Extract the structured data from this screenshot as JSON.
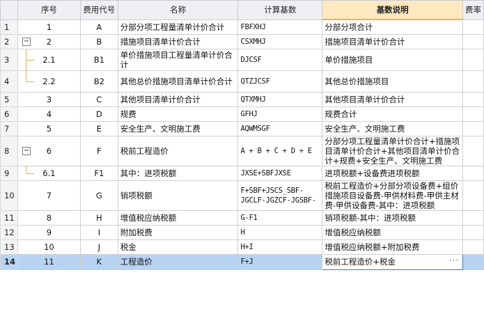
{
  "headers": {
    "seq": "序号",
    "code": "费用代号",
    "name": "名称",
    "base": "计算基数",
    "desc": "基数说明",
    "rate": "费率"
  },
  "rows": [
    {
      "rownum": "1",
      "seq": "1",
      "code": "A",
      "name": "分部分项工程量清单计价合计",
      "base": "FBFXHJ",
      "desc": "分部分项合计"
    },
    {
      "rownum": "2",
      "seq": "2",
      "code": "B",
      "name": "措施项目清单计价合计",
      "base": "CSXMHJ",
      "desc": "措施项目清单计价合计",
      "toggle": "−"
    },
    {
      "rownum": "3",
      "seq": "2.1",
      "code": "B1",
      "name": "单价措施项目工程量清单计价合计",
      "base": "DJCSF",
      "desc": "单价措施项目"
    },
    {
      "rownum": "4",
      "seq": "2.2",
      "code": "B2",
      "name": "其他总价措施项目清单计价合计",
      "base": "QTZJCSF",
      "desc": "其他总价措施项目"
    },
    {
      "rownum": "5",
      "seq": "3",
      "code": "C",
      "name": "其他项目清单计价合计",
      "base": "QTXMHJ",
      "desc": "其他项目清单计价合计"
    },
    {
      "rownum": "6",
      "seq": "4",
      "code": "D",
      "name": "规费",
      "base": "GFHJ",
      "desc": "规费合计"
    },
    {
      "rownum": "7",
      "seq": "5",
      "code": "E",
      "name": "安全生产、文明施工费",
      "base": "AQWMSGF",
      "desc": "安全生产、文明施工费"
    },
    {
      "rownum": "8",
      "seq": "6",
      "code": "F",
      "name": "税前工程造价",
      "base": "A + B + C + D + E",
      "desc": "分部分项工程量清单计价合计+措施项目清单计价合计+其他项目清单计价合计+规费+安全生产、文明施工费",
      "toggle": "−"
    },
    {
      "rownum": "9",
      "seq": "6.1",
      "code": "F1",
      "name": "其中：进项税额",
      "base": "JXSE+SBFJXSE",
      "desc": "进项税额+设备费进项税额"
    },
    {
      "rownum": "10",
      "seq": "7",
      "code": "G",
      "name": "销项税额",
      "base": "F+SBF+JSCS_SBF-JGCLF-JGZCF-JGSBF-",
      "desc": "税前工程造价+分部分项设备费+组价措施项目设备费-甲供材料费-甲供主材费-甲供设备费-其中：进项税额"
    },
    {
      "rownum": "11",
      "seq": "8",
      "code": "H",
      "name": "增值税应纳税额",
      "base": "G-F1",
      "desc": "销项税额-其中：进项税额"
    },
    {
      "rownum": "12",
      "seq": "9",
      "code": "I",
      "name": "附加税费",
      "base": "H",
      "desc": "增值税应纳税额"
    },
    {
      "rownum": "13",
      "seq": "10",
      "code": "J",
      "name": "税金",
      "base": "H+I",
      "desc": "增值税应纳税额+附加税费"
    },
    {
      "rownum": "14",
      "seq": "11",
      "code": "K",
      "name": "工程造价",
      "base": "F+J",
      "desc": "税前工程造价+税金",
      "selected": true
    }
  ],
  "ellipsis": "···"
}
